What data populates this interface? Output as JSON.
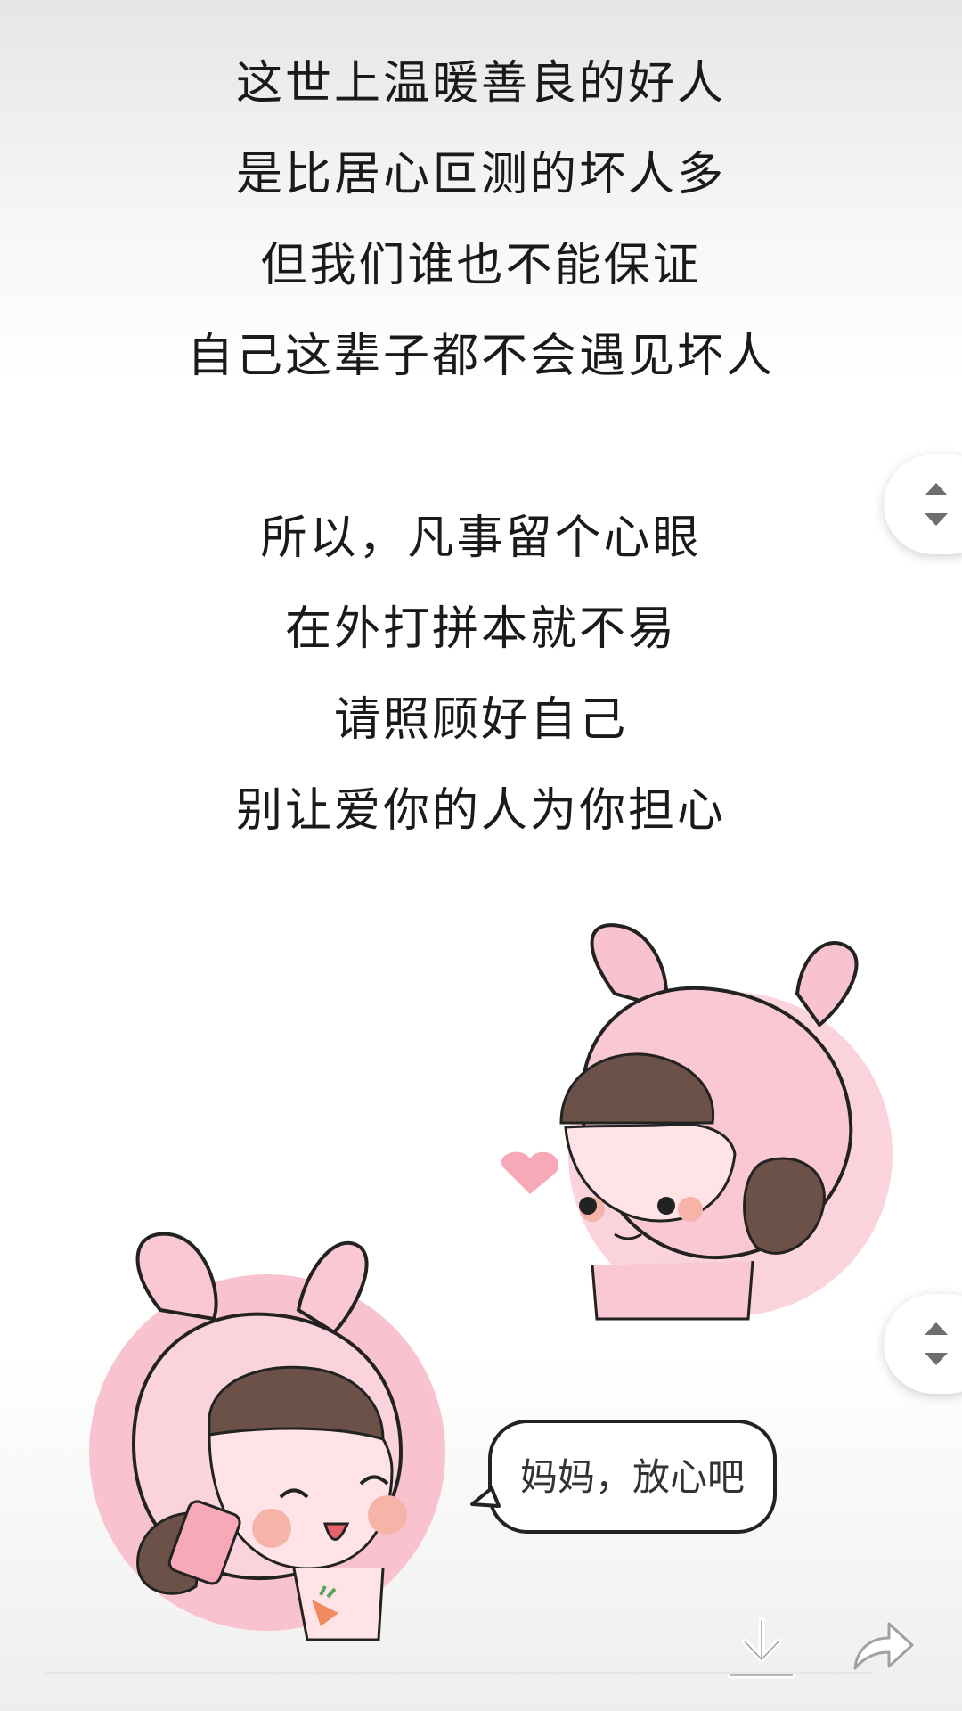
{
  "poem": {
    "lines": [
      "这世上温暖善良的好人",
      "是比居心叵测的坏人多",
      "但我们谁也不能保证",
      "自己这辈子都不会遇见坏人",
      "所以，凡事留个心眼",
      "在外打拼本就不易",
      "请照顾好自己",
      "别让爱你的人为你担心"
    ]
  },
  "illustration": {
    "speech_bubble": "妈妈，放心吧"
  },
  "colors": {
    "text": "#1a1a1a",
    "pink_light": "#fbd3dc",
    "pink_face": "#ffe3e7",
    "hair": "#6b5148",
    "ui_gray": "#6e6e6e"
  },
  "icons": {
    "scroll_up": "triangle-up-icon",
    "scroll_down": "triangle-down-icon",
    "download": "download-icon",
    "share": "share-icon"
  }
}
